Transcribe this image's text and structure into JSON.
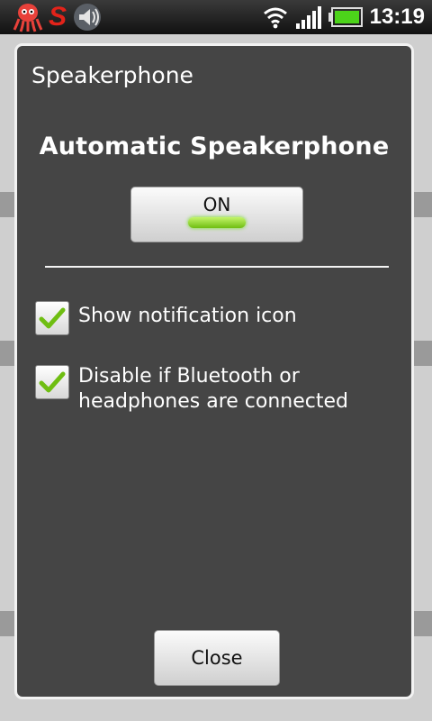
{
  "status_bar": {
    "app_logo_text": "S",
    "time": "13:19",
    "colors": {
      "logo": "#e2231a",
      "battery": "#4cd31a"
    }
  },
  "dialog": {
    "title": "Speakerphone",
    "headline": "Automatic Speakerphone",
    "toggle": {
      "label": "ON",
      "state": "on"
    },
    "options": [
      {
        "label": "Show notification icon",
        "checked": true
      },
      {
        "label": "Disable if Bluetooth or headphones are connected",
        "checked": true
      }
    ],
    "close_label": "Close"
  }
}
